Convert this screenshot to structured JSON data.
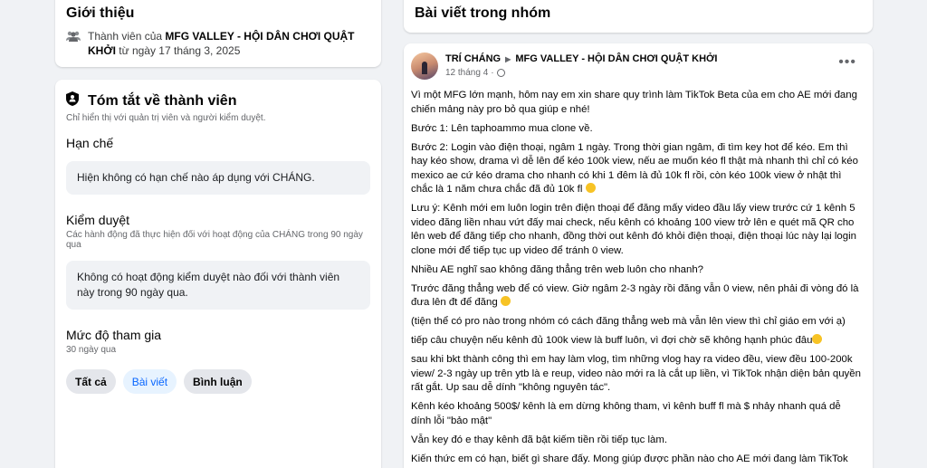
{
  "intro": {
    "title": "Giới thiệu",
    "line_prefix": "Thành viên của ",
    "group_name": "MFG VALLEY - HỘI DÂN CHƠI QUẬT KHỞI",
    "line_suffix": " từ ngày 17 tháng 3, 2025",
    "icon": "members-icon"
  },
  "summary": {
    "title": "Tóm tắt về thành viên",
    "subtitle": "Chỉ hiển thị với quản trị viên và người kiểm duyệt.",
    "restrictions": {
      "title": "Hạn chế",
      "text": "Hiện không có hạn chế nào áp dụng với CHÁNG."
    },
    "moderation": {
      "title": "Kiểm duyệt",
      "subtitle": "Các hành động đã thực hiện đối với hoạt động của CHÁNG trong 90 ngày qua",
      "text": "Không có hoạt động kiểm duyệt nào đối với thành viên này trong 90 ngày qua."
    },
    "participation": {
      "title": "Mức độ tham gia",
      "subtitle": "30 ngày qua",
      "pills": [
        {
          "label": "Tất cả",
          "active": false
        },
        {
          "label": "Bài viết",
          "active": true
        },
        {
          "label": "Bình luận",
          "active": false
        }
      ]
    }
  },
  "posts": {
    "title": "Bài viết trong nhóm"
  },
  "post": {
    "author": "TRÍ CHÁNG",
    "arrow": "▶",
    "group": "MFG VALLEY - HỘI DÂN CHƠI QUẬT KHỞI",
    "date": "12 tháng 4",
    "dot": "·",
    "more": "•••",
    "paragraphs": [
      "Vì một MFG lớn mạnh, hôm nay em xin share quy trình làm TikTok Beta của em cho AE mới đang chiến mảng này pro bỏ qua giúp e nhé!",
      "Bước 1: Lên taphoammo mua clone về.",
      "Bước 2: Login vào điện thoại, ngâm 1 ngày. Trong thời gian ngâm, đi tìm key hot để kéo. Em thì hay kéo show, drama vì dễ lên để kéo 100k view, nếu ae muốn kéo fl thật mà nhanh thì chỉ có kéo mexico ae cứ kéo drama cho nhanh có khi 1 đêm là đủ 10k fl rồi, còn kéo 100k view ở nhật thì chắc là 1 năm chưa chắc đã đủ 10k fl",
      "Lưu ý: Kênh mới em luôn login trên điện thoại để đăng mấy video đầu lấy view trước cứ 1 kênh 5 video đăng liền nhau vứt đấy mai check, nếu kênh có khoảng 100 view trở lên e quét mã QR cho lên web để đăng tiếp cho nhanh, đồng thời out kênh đó khỏi điện thoại, điện thoại lúc này lại login clone mới để tiếp tục up video để tránh 0 view.",
      "Nhiều AE nghĩ sao không đăng thẳng trên web luôn cho nhanh?",
      "Trước đăng thẳng web để có view. Giờ ngâm 2-3 ngày rồi đăng vẫn 0 view, nên phải đi vòng đó là đưa lên đt để đăng",
      "(tiện thể có pro nào trong nhóm có cách đăng thẳng web mà vẫn lên view thì chỉ giáo em với ạ)",
      "tiếp câu chuyện nếu kênh đủ 100k view là buff luôn, vì đợi chờ sẽ không hạnh phúc đâu",
      "sau khi bkt thành công thì em hay làm vlog, tìm những vlog hay ra video đều, view đều 100-200k view/ 2-3 ngày up trên ytb là e reup, video nào mới ra là cắt up liền, vì TikTok nhận diện bản quyền rất gắt. Up sau dễ dính \"không nguyên tác\".",
      "Kênh kéo khoảng 500$/ kênh là em dừng không tham, vì kênh buff fl mà  $ nhảy nhanh quá dễ dính lỗi \"bảo mật\"",
      "Vẫn key đó e thay kênh đã bật kiếm tiền rồi tiếp tục làm.",
      "Kiến thức em có hạn, biết gì share đấy. Mong giúp được phần nào cho AE mới đang làm TikTok Beta"
    ]
  },
  "colors": {
    "background": "#f0f2f5",
    "accent": "#0866ff",
    "pill_active_bg": "#e7f3ff"
  }
}
